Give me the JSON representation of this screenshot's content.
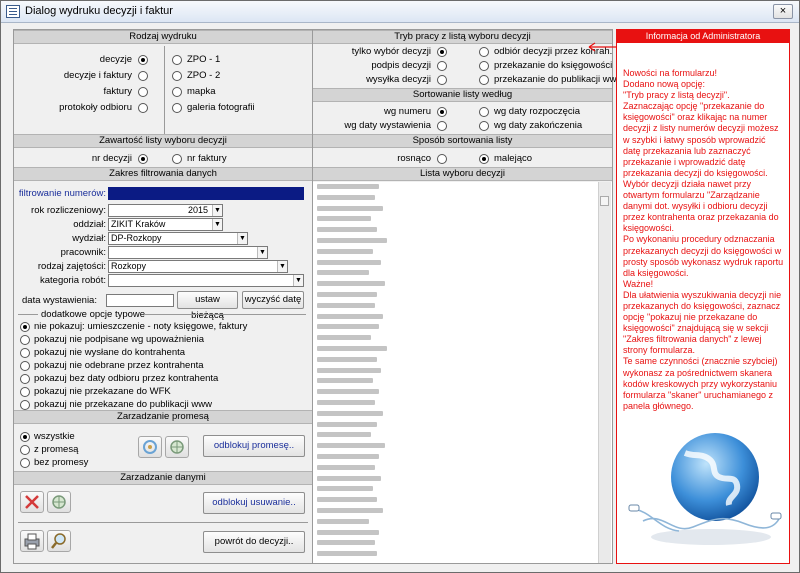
{
  "window": {
    "title": "Dialog wydruku decyzji i faktur",
    "close_label": "×"
  },
  "rodzaj": {
    "header": "Rodzaj wydruku",
    "left": [
      {
        "label": "decyzje",
        "selected": true
      },
      {
        "label": "decyzje i faktury",
        "selected": false
      },
      {
        "label": "faktury",
        "selected": false
      },
      {
        "label": "protokoły odbioru",
        "selected": false
      }
    ],
    "right": [
      {
        "label": "ZPO - 1",
        "selected": false
      },
      {
        "label": "ZPO - 2",
        "selected": false
      },
      {
        "label": "mapka",
        "selected": false
      },
      {
        "label": "galeria fotografii",
        "selected": false
      }
    ]
  },
  "tryb": {
    "header": "Tryb pracy z listą wyboru decyzji",
    "left": [
      {
        "label": "tylko wybór decyzji",
        "selected": true
      },
      {
        "label": "podpis decyzji",
        "selected": false
      },
      {
        "label": "wysyłka decyzji",
        "selected": false
      }
    ],
    "right": [
      {
        "label": "odbiór decyzji przez konrah.",
        "selected": false
      },
      {
        "label": "przekazanie do księgowości",
        "selected": false
      },
      {
        "label": "przekazanie do publikacji www",
        "selected": false
      }
    ]
  },
  "sortowanie": {
    "header": "Sortowanie listy według",
    "left": [
      {
        "label": "wg numeru",
        "selected": true
      },
      {
        "label": "wg daty wystawienia",
        "selected": false
      }
    ],
    "right": [
      {
        "label": "wg daty rozpoczęcia",
        "selected": false
      },
      {
        "label": "wg daty zakończenia",
        "selected": false
      }
    ]
  },
  "zawartosc": {
    "header": "Zawartość listy wyboru decyzji",
    "left": {
      "label": "nr decyzji",
      "selected": true
    },
    "right": {
      "label": "nr faktury",
      "selected": false
    }
  },
  "sposob": {
    "header": "Sposób sortowania listy",
    "left": {
      "label": "rosnąco",
      "selected": false
    },
    "right": {
      "label": "malejąco",
      "selected": true
    }
  },
  "zakres": {
    "header": "Zakres filtrowania danych",
    "filter_label": "filtrowanie numerów:",
    "filter_value": "",
    "rok_label": "rok rozliczeniowy:",
    "rok_value": "2015",
    "oddzial_label": "oddział:",
    "oddzial_value": "ZIKIT Kraków",
    "wydzial_label": "wydział:",
    "wydzial_value": "DP-Rozkopy",
    "pracownik_label": "pracownik:",
    "pracownik_value": "",
    "rodzaj_label": "rodzaj zajętości:",
    "rodzaj_value": "Rozkopy",
    "kategoria_label": "kategoria robót:",
    "kategoria_value": "",
    "data_label": "data wystawienia:",
    "data_value": "",
    "ustaw_btn": "ustaw bieżącą",
    "wyczysc_btn": "wyczyść datę",
    "dodatkowe_label": "dodatkowe opcje typowe",
    "opcje": [
      {
        "label": "nie pokazuj: umieszczenie - noty księgowe, faktury",
        "selected": true
      },
      {
        "label": "pokazuj nie podpisane wg upoważnienia",
        "selected": false
      },
      {
        "label": "pokazuj nie wysłane do kontrahenta",
        "selected": false
      },
      {
        "label": "pokazuj nie odebrane przez kontrahenta",
        "selected": false
      },
      {
        "label": "pokazuj bez daty odbioru przez kontrahenta",
        "selected": false
      },
      {
        "label": "pokazuj nie przekazane do WFK",
        "selected": false
      },
      {
        "label": "pokazuj nie przekazane do publikacji www",
        "selected": false
      }
    ]
  },
  "lista": {
    "header": "Lista wyboru decyzji"
  },
  "promesy": {
    "header": "Zarzadzanie promesą",
    "options": [
      {
        "label": "wszystkie",
        "selected": true
      },
      {
        "label": "z promesą",
        "selected": false
      },
      {
        "label": "bez promesy",
        "selected": false
      }
    ],
    "odblokuj_btn": "odblokuj promesę.."
  },
  "dane": {
    "header": "Zarzadzanie danymi",
    "odblokuj_btn": "odblokuj usuwanie..",
    "powrot_btn": "powrót do decyzji.."
  },
  "admin": {
    "header": "Informacja od Administratora",
    "text": "Nowości na formularzu!\nDodano nową opcję:\n\"Tryb pracy z listą decyzji\".\nZaznaczając opcję \"przekazanie do księgowości\" oraz klikając na numer decyzji z listy numerów decyzji możesz w szybki i łatwy sposób wprowadzić datę przekazania lub zaznaczyć przekazanie i wprowadzić datę przekazania decyzji do księgowości. Wybór decyzji działa nawet przy otwartym formularzu \"Zarządzanie danymi dot. wysyłki i odbioru decyzji przez kontrahenta oraz przekazania do księgowości.\nPo wykonaniu procedury odznaczania przekazanych decyzji do księgowości w prosty sposób wykonasz wydruk raportu dla księgowości.\nWażne!\nDla ułatwienia wyszukiwania decyzji nie przekazanych do księgowości, zaznacz opcję \"pokazuj nie przekazane do księgowości\" znajdującą się w sekcji \"Zakres filtrowania danych\" z lewej strony formularza.\nTe same czynności (znacznie szybciej) wykonasz za pośrednictwem skanera kodów kreskowych przy wykorzystaniu formularza \"skaner\" uruchamianego z panela głównego."
  }
}
